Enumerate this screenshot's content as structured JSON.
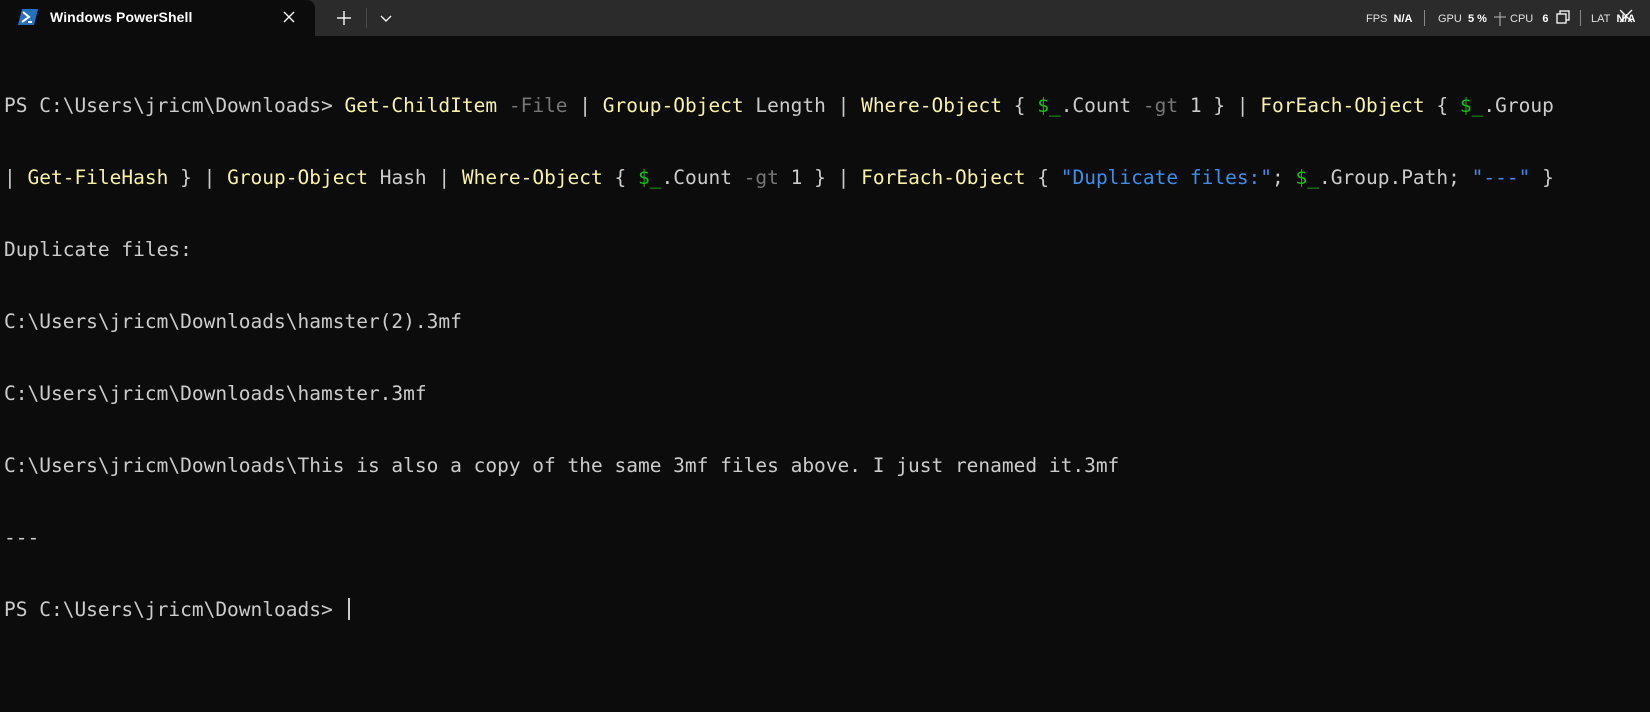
{
  "tab": {
    "title": "Windows PowerShell",
    "icon": "powershell-icon"
  },
  "toolbar": {
    "new_tab_icon": "plus-icon",
    "dropdown_icon": "chevron-down-icon"
  },
  "perf": {
    "fps_label": "FPS",
    "fps_value": "N/A",
    "gpu_label": "GPU",
    "gpu_value": "5 %",
    "cpu_label": "CPU",
    "cpu_value": "6",
    "lat_label": "LAT",
    "lat_value": "N/A"
  },
  "terminal": {
    "prompt": "PS C:\\Users\\jricm\\Downloads> ",
    "command_line1": [
      {
        "t": "Get-ChildItem",
        "c": "cmd"
      },
      {
        "t": " ",
        "c": "plain"
      },
      {
        "t": "-File",
        "c": "param"
      },
      {
        "t": " | ",
        "c": "plain"
      },
      {
        "t": "Group-Object",
        "c": "cmd"
      },
      {
        "t": " Length | ",
        "c": "plain"
      },
      {
        "t": "Where-Object",
        "c": "cmd"
      },
      {
        "t": " { ",
        "c": "plain"
      },
      {
        "t": "$_",
        "c": "var"
      },
      {
        "t": ".Count ",
        "c": "plain"
      },
      {
        "t": "-gt",
        "c": "param"
      },
      {
        "t": " 1 } | ",
        "c": "plain"
      },
      {
        "t": "ForEach-Object",
        "c": "cmd"
      },
      {
        "t": " { ",
        "c": "plain"
      },
      {
        "t": "$_",
        "c": "var"
      },
      {
        "t": ".Group",
        "c": "plain"
      }
    ],
    "command_line2": [
      {
        "t": "| ",
        "c": "plain"
      },
      {
        "t": "Get-FileHash",
        "c": "cmd"
      },
      {
        "t": " } | ",
        "c": "plain"
      },
      {
        "t": "Group-Object",
        "c": "cmd"
      },
      {
        "t": " Hash | ",
        "c": "plain"
      },
      {
        "t": "Where-Object",
        "c": "cmd"
      },
      {
        "t": " { ",
        "c": "plain"
      },
      {
        "t": "$_",
        "c": "var"
      },
      {
        "t": ".Count ",
        "c": "plain"
      },
      {
        "t": "-gt",
        "c": "param"
      },
      {
        "t": " 1 } | ",
        "c": "plain"
      },
      {
        "t": "ForEach-Object",
        "c": "cmd"
      },
      {
        "t": " { ",
        "c": "plain"
      },
      {
        "t": "\"Duplicate files:\"",
        "c": "str"
      },
      {
        "t": "; ",
        "c": "plain"
      },
      {
        "t": "$_",
        "c": "var"
      },
      {
        "t": ".Group.Path; ",
        "c": "plain"
      },
      {
        "t": "\"---\"",
        "c": "str"
      },
      {
        "t": " }",
        "c": "plain"
      }
    ],
    "output": [
      "Duplicate files:",
      "C:\\Users\\jricm\\Downloads\\hamster(2).3mf",
      "C:\\Users\\jricm\\Downloads\\hamster.3mf",
      "C:\\Users\\jricm\\Downloads\\This is also a copy of the same 3mf files above. I just renamed it.3mf",
      "---"
    ],
    "final_prompt": "PS C:\\Users\\jricm\\Downloads> "
  },
  "colors": {
    "background": "#0c0c0c",
    "tabbar": "#2b2b2b",
    "cmdlet": "#f9f1a5",
    "parameter": "#767676",
    "variable": "#13c310",
    "string": "#3b8eea",
    "text": "#cccccc"
  }
}
